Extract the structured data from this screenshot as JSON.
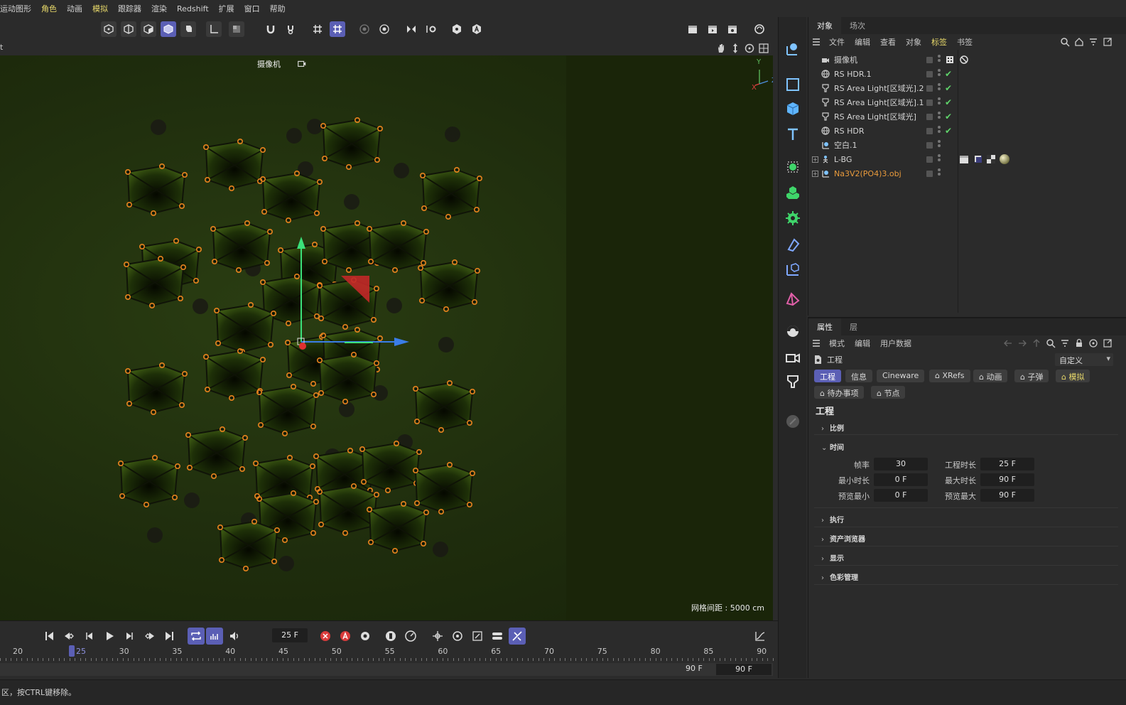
{
  "menu": [
    "运动图形",
    "角色",
    "动画",
    "模拟",
    "跟踪器",
    "渲染",
    "Redshift",
    "扩展",
    "窗口",
    "帮助"
  ],
  "viewport": {
    "camera_label": "摄像机",
    "grid_info": "网格间距 : 5000 cm",
    "axis_y": "Y",
    "axis_z": "Z",
    "axis_x": "X",
    "left_fragment": "t"
  },
  "object_manager": {
    "tabs": [
      "对象",
      "场次"
    ],
    "submenu": [
      "文件",
      "编辑",
      "查看",
      "对象",
      "标签",
      "书签"
    ],
    "objects": [
      {
        "name": "摄像机",
        "icon": "camera-icon",
        "check": ""
      },
      {
        "name": "RS HDR.1",
        "icon": "globe-icon",
        "check": "✔"
      },
      {
        "name": "RS Area Light[区域光].2",
        "icon": "light-icon",
        "check": "✔"
      },
      {
        "name": "RS Area Light[区域光].1",
        "icon": "light-icon",
        "check": "✔"
      },
      {
        "name": "RS Area Light[区域光]",
        "icon": "light-icon",
        "check": "✔"
      },
      {
        "name": "RS HDR",
        "icon": "globe-icon",
        "check": "✔"
      },
      {
        "name": "空白.1",
        "icon": "null-icon",
        "check": ""
      },
      {
        "name": "L-BG",
        "icon": "figure-icon",
        "check": ""
      },
      {
        "name": "Na3V2(PO4)3.obj",
        "icon": "null-icon",
        "check": ""
      }
    ]
  },
  "attributes": {
    "tabs": [
      "属性",
      "层"
    ],
    "submenu": [
      "模式",
      "编辑",
      "用户数据"
    ],
    "head_title": "工程",
    "dropdown": "自定义",
    "pills_row1": [
      "工程",
      "信息",
      "Cineware",
      "XRefs",
      "动画",
      "子弹",
      "模拟"
    ],
    "pills_row2": [
      "待办事项",
      "节点"
    ],
    "section_title": "工程",
    "groups": [
      "比例",
      "时间",
      "执行",
      "资产浏览器",
      "显示",
      "色彩管理"
    ],
    "time_fields": {
      "fps_label": "帧率",
      "fps": "30",
      "duration_label": "工程时长",
      "duration": "25 F",
      "min_label": "最小时长",
      "min": "0 F",
      "max_label": "最大时长",
      "max": "90 F",
      "pmin_label": "预览最小",
      "pmin": "0 F",
      "pmax_label": "预览最大",
      "pmax": "90 F"
    }
  },
  "timeline": {
    "current_frame": "25 F",
    "ticks": [
      "20",
      "25",
      "30",
      "35",
      "40",
      "45",
      "50",
      "55",
      "60",
      "65",
      "70",
      "75",
      "80",
      "85",
      "90"
    ],
    "playhead_label": "25",
    "range_end": "90 F",
    "range_box": "90 F"
  },
  "status": "区，按CTRL键移除。",
  "colors": {
    "accent": "#5b5fb5",
    "highlight_text": "#e8d96a",
    "check_green": "#5fd36a",
    "orange_name": "#e89a3c"
  }
}
